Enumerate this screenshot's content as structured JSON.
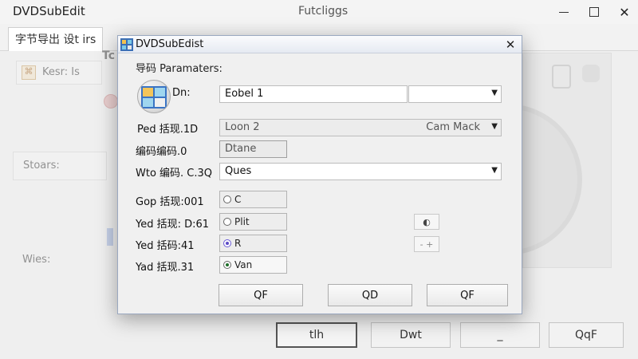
{
  "background": {
    "title": "DVDSubEdit",
    "center_title": "Futcliggs",
    "tab_label": "字节导出 设t irs",
    "side_label_1": "Tc",
    "side_label_2": "Kesr: Is",
    "side_label_3": "Stoars:",
    "side_label_4": "Wies:",
    "buttons": {
      "primary": "tlh",
      "second": "Dwt",
      "third": "_",
      "fourth": "QqF"
    }
  },
  "dialog": {
    "title": "DVDSubEdist",
    "close_glyph": "✕",
    "heading": "导码 Paramaters:",
    "icon_label": "Dn:",
    "name_field": "Eobel 1",
    "row1_label": "Ped 括现.1D",
    "row1_combo_left": "Loon 2",
    "row1_combo_right": "Cam Mack",
    "row2_label": "编码编码.0",
    "row2_button": "Dtane",
    "row3_label": "Wto 编码. C.3Q",
    "row3_combo": "Ques",
    "opt1_label": "Gop 括现:001",
    "opt1_value": "C",
    "opt2_label": "Yed 括现: D:61",
    "opt2_value": "Plit",
    "opt3_label": "Yed 括码:41",
    "opt3_value": "R",
    "opt4_label": "Yad 括现.31",
    "opt4_value": "Van",
    "side_small_1": "◐",
    "side_small_2": "- +",
    "buttons": {
      "left": "QF",
      "middle": "QD",
      "right": "QF"
    }
  },
  "colors": {
    "dialog_border": "#9aa8c0",
    "accent_blue": "#2a6fd0",
    "radio_green": "#1f6f2a",
    "radio_purple": "#5b4bc6"
  }
}
